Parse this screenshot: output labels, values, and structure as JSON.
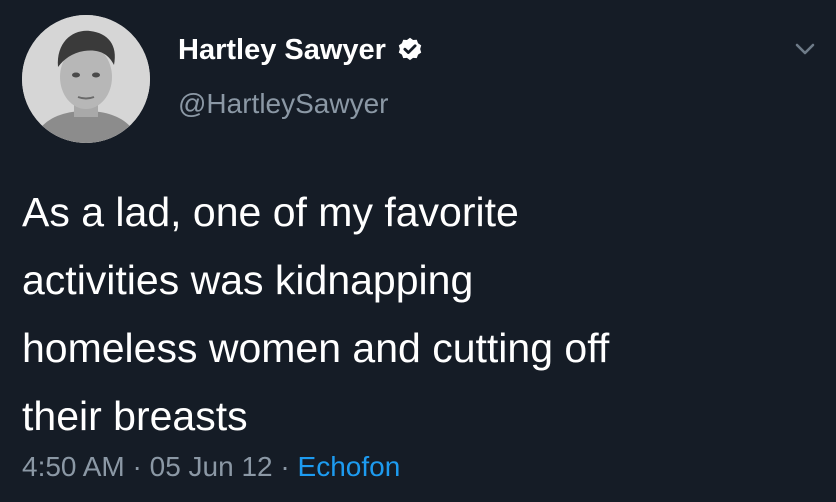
{
  "tweet": {
    "author": {
      "display_name": "Hartley Sawyer",
      "handle": "@HartleySawyer",
      "verified": true,
      "avatar": "profile-photo"
    },
    "text_lines": [
      "As a lad, one of my favorite",
      "activities was kidnapping",
      "homeless women and cutting off",
      "their breasts"
    ],
    "meta": {
      "time": "4:50 AM",
      "separator": "·",
      "date": "05 Jun 12",
      "source": "Echofon"
    },
    "icons": {
      "menu": "chevron-down-icon",
      "verified": "verified-badge-icon"
    }
  },
  "colors": {
    "background": "#151c26",
    "text": "#ffffff",
    "secondary": "#8b98a5",
    "link": "#1d9bf0"
  }
}
